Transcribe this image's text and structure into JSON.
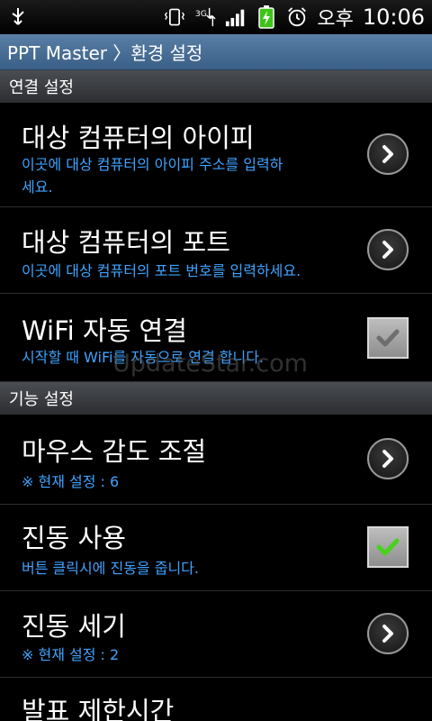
{
  "status_bar": {
    "ampm": "오후",
    "time": "10:06",
    "network": "3G"
  },
  "titlebar": {
    "title": "PPT Master 〉환경 설정"
  },
  "sections": [
    {
      "label": "연결 설정"
    },
    {
      "label": "기능 설정"
    }
  ],
  "rows": [
    {
      "title": "대상 컴퓨터의 아이피",
      "subtitle": "이곳에 대상 컴퓨터의 아이피 주소를 입력하세요.",
      "control": "chevron"
    },
    {
      "title": "대상 컴퓨터의 포트",
      "subtitle": "이곳에 대상 컴퓨터의 포트 번호를 입력하세요.",
      "control": "chevron"
    },
    {
      "title": "WiFi 자동 연결",
      "subtitle": "시작할 때 WiFi를 자동으로 연결 합니다.",
      "control": "checkbox",
      "checked": false
    },
    {
      "title": "마우스 감도 조절",
      "subtitle": "※ 현재 설정 : 6",
      "control": "chevron"
    },
    {
      "title": "진동 사용",
      "subtitle": "버튼 클릭시에 진동을 줍니다.",
      "control": "checkbox",
      "checked": true
    },
    {
      "title": "진동 세기",
      "subtitle": "※ 현재 설정 : 2",
      "control": "chevron"
    },
    {
      "title": "발표 제한시간",
      "subtitle": "",
      "control": "chevron"
    }
  ],
  "watermark": "UpdateStar.com",
  "colors": {
    "subtitle": "#3fa3ff",
    "check_on": "#49d11f",
    "title_bar": "#4a6f96"
  }
}
